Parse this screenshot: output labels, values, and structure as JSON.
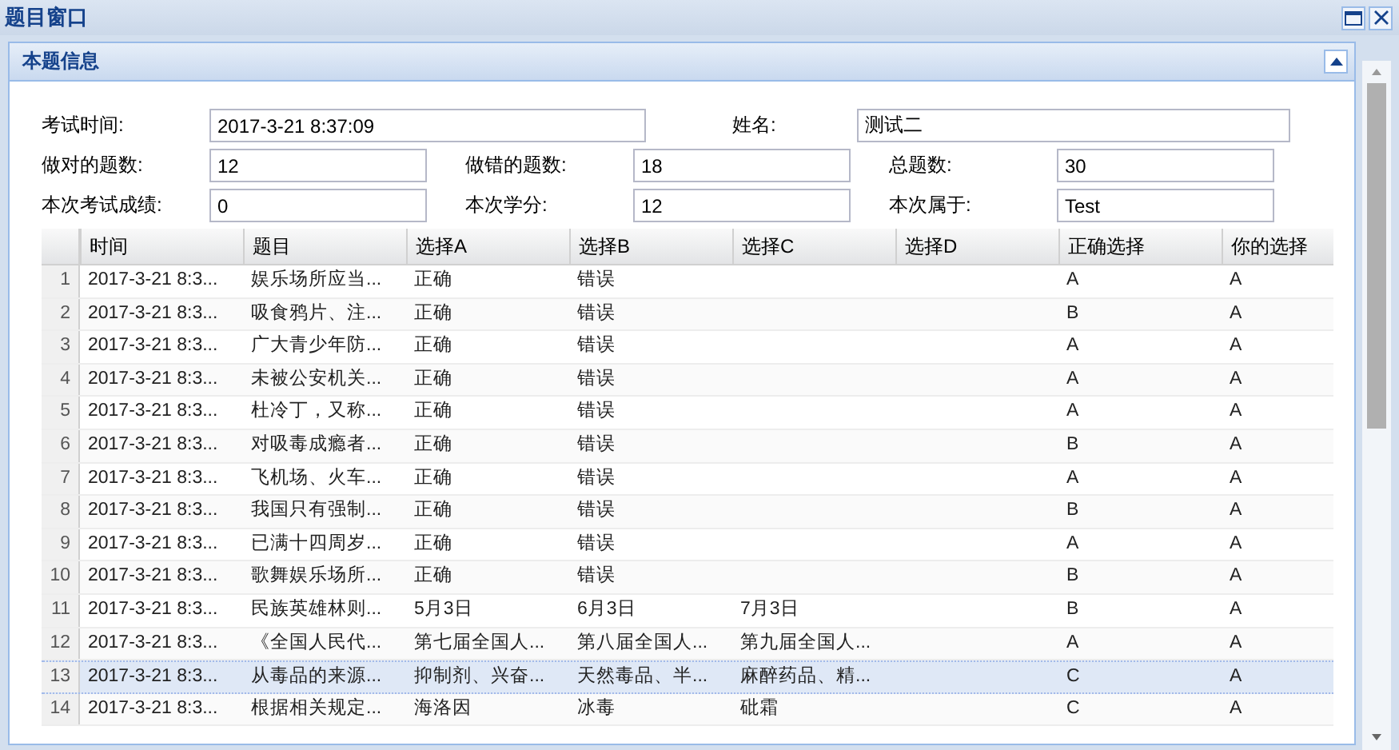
{
  "window": {
    "title": "题目窗口"
  },
  "panel": {
    "title": "本题信息",
    "collapsed": false
  },
  "form": {
    "row1": [
      {
        "label": "考试时间:",
        "value": "2017-3-21 8:37:09"
      },
      {
        "label": "姓名:",
        "value": "测试二"
      }
    ],
    "row2": [
      {
        "label": "做对的题数:",
        "value": "12"
      },
      {
        "label": "做错的题数:",
        "value": "18"
      },
      {
        "label": "总题数:",
        "value": "30"
      }
    ],
    "row3": [
      {
        "label": "本次考试成绩:",
        "value": "0"
      },
      {
        "label": "本次学分:",
        "value": "12"
      },
      {
        "label": "本次属于:",
        "value": "Test"
      }
    ]
  },
  "table": {
    "columns": [
      "时间",
      "题目",
      "选择A",
      "选择B",
      "选择C",
      "选择D",
      "正确选择",
      "你的选择"
    ],
    "rows": [
      {
        "number": "1",
        "cells": [
          "2017-3-21 8:3...",
          "娱乐场所应当...",
          "正确",
          "错误",
          "",
          "",
          "A",
          "A"
        ],
        "selected": false
      },
      {
        "number": "2",
        "cells": [
          "2017-3-21 8:3...",
          "吸食鸦片、注...",
          "正确",
          "错误",
          "",
          "",
          "B",
          "A"
        ],
        "selected": false
      },
      {
        "number": "3",
        "cells": [
          "2017-3-21 8:3...",
          "广大青少年防...",
          "正确",
          "错误",
          "",
          "",
          "A",
          "A"
        ],
        "selected": false
      },
      {
        "number": "4",
        "cells": [
          "2017-3-21 8:3...",
          "未被公安机关...",
          "正确",
          "错误",
          "",
          "",
          "A",
          "A"
        ],
        "selected": false
      },
      {
        "number": "5",
        "cells": [
          "2017-3-21 8:3...",
          "杜冷丁，又称...",
          "正确",
          "错误",
          "",
          "",
          "A",
          "A"
        ],
        "selected": false
      },
      {
        "number": "6",
        "cells": [
          "2017-3-21 8:3...",
          "对吸毒成瘾者...",
          "正确",
          "错误",
          "",
          "",
          "B",
          "A"
        ],
        "selected": false
      },
      {
        "number": "7",
        "cells": [
          "2017-3-21 8:3...",
          "飞机场、火车...",
          "正确",
          "错误",
          "",
          "",
          "A",
          "A"
        ],
        "selected": false
      },
      {
        "number": "8",
        "cells": [
          "2017-3-21 8:3...",
          "我国只有强制...",
          "正确",
          "错误",
          "",
          "",
          "B",
          "A"
        ],
        "selected": false
      },
      {
        "number": "9",
        "cells": [
          "2017-3-21 8:3...",
          "已满十四周岁...",
          "正确",
          "错误",
          "",
          "",
          "A",
          "A"
        ],
        "selected": false
      },
      {
        "number": "10",
        "cells": [
          "2017-3-21 8:3...",
          "歌舞娱乐场所...",
          "正确",
          "错误",
          "",
          "",
          "B",
          "A"
        ],
        "selected": false
      },
      {
        "number": "11",
        "cells": [
          "2017-3-21 8:3...",
          "民族英雄林则...",
          "5月3日",
          "6月3日",
          "7月3日",
          "",
          "B",
          "A"
        ],
        "selected": false
      },
      {
        "number": "12",
        "cells": [
          "2017-3-21 8:3...",
          "《全国人民代...",
          "第七届全国人...",
          "第八届全国人...",
          "第九届全国人...",
          "",
          "A",
          "A"
        ],
        "selected": false
      },
      {
        "number": "13",
        "cells": [
          "2017-3-21 8:3...",
          "从毒品的来源...",
          "抑制剂、兴奋...",
          "天然毒品、半...",
          "麻醉药品、精...",
          "",
          "C",
          "A"
        ],
        "selected": true
      },
      {
        "number": "14",
        "cells": [
          "2017-3-21 8:3...",
          "根据相关规定...",
          "海洛因",
          "冰毒",
          "砒霜",
          "",
          "C",
          "A"
        ],
        "selected": false
      }
    ]
  }
}
